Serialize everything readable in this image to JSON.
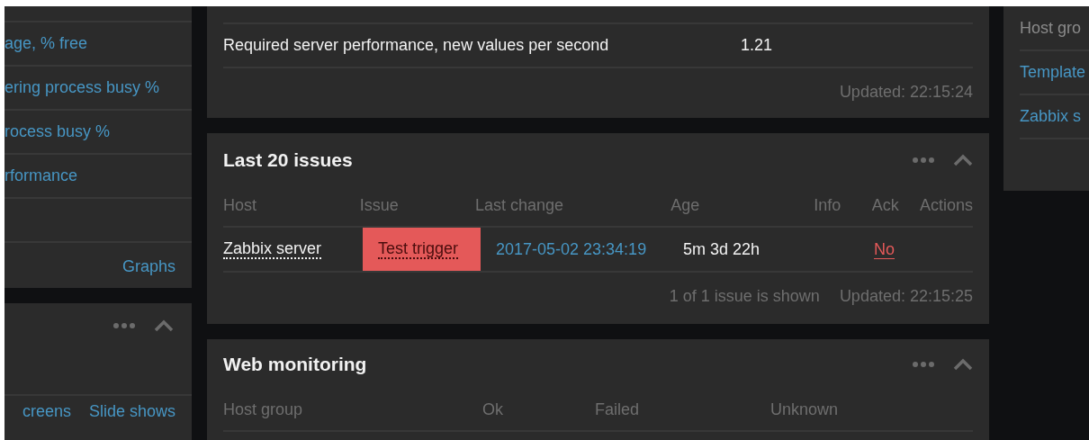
{
  "left_panels": [
    {
      "items": [
        "age, % free",
        "ering process busy %",
        "rocess busy %",
        "rformance"
      ],
      "footer_links": [
        "Graphs"
      ]
    },
    {
      "footer_links": [
        "creens",
        "Slide shows"
      ]
    }
  ],
  "server_info": {
    "rows": [
      {
        "label": "Required server performance, new values per second",
        "value": "1.21"
      }
    ],
    "updated": "Updated: 22:15:24"
  },
  "issues": {
    "title": "Last 20 issues",
    "columns": [
      "Host",
      "Issue",
      "Last change",
      "Age",
      "Info",
      "Ack",
      "Actions"
    ],
    "rows": [
      {
        "host": "Zabbix server",
        "issue": "Test trigger",
        "color": "#e45959",
        "last_change": "2017-05-02 23:34:19",
        "age": "5m 3d 22h",
        "ack": "No",
        "acknowledged": false
      }
    ],
    "shown": "1 of 1 issue is shown",
    "updated": "Updated: 22:15:25"
  },
  "web_monitoring": {
    "title": "Web monitoring",
    "columns": [
      "Host group",
      "Ok",
      "Failed",
      "Unknown"
    ]
  },
  "right_panel": {
    "header": "Host gro",
    "items": [
      "Template",
      "Zabbix s"
    ]
  }
}
